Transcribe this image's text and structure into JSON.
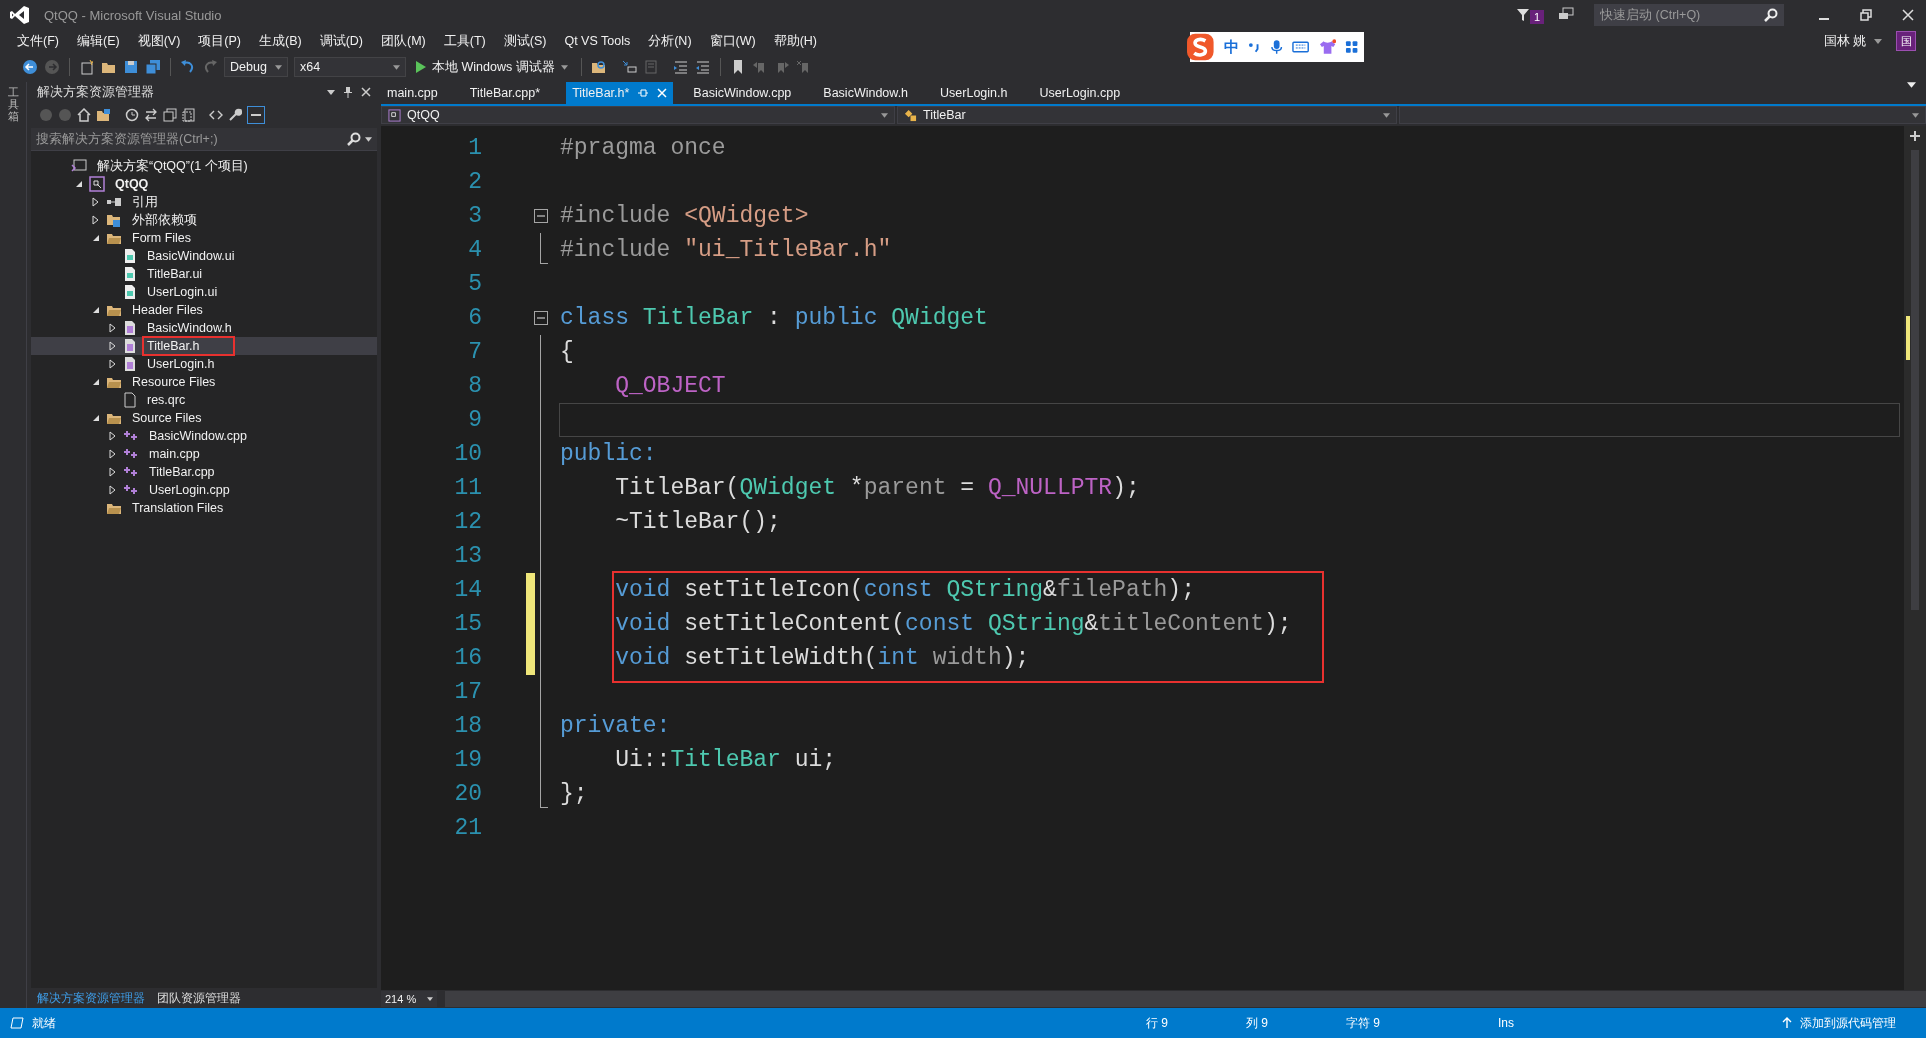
{
  "window": {
    "title": "QtQQ - Microsoft Visual Studio"
  },
  "notifications": {
    "count": "1"
  },
  "quick_launch": {
    "placeholder": "快速启动 (Ctrl+Q)"
  },
  "user": {
    "name": "国林 姚",
    "initial": "国"
  },
  "ime_toolbar": {
    "mode": "中"
  },
  "menu": [
    "文件(F)",
    "编辑(E)",
    "视图(V)",
    "项目(P)",
    "生成(B)",
    "调试(D)",
    "团队(M)",
    "工具(T)",
    "测试(S)",
    "Qt VS Tools",
    "分析(N)",
    "窗口(W)",
    "帮助(H)"
  ],
  "toolbar": {
    "configuration": "Debug",
    "platform": "x64",
    "run": "本地 Windows 调试器"
  },
  "toolbox_strip": {
    "label": "工具箱"
  },
  "solution_explorer": {
    "title": "解决方案资源管理器",
    "search_placeholder": "搜索解决方案资源管理器(Ctrl+;)",
    "tree": [
      {
        "label": "解决方案“QtQQ”(1 个项目)",
        "kind": "solution",
        "selected": false,
        "marked": false,
        "children": [
          {
            "label": "QtQQ",
            "kind": "project",
            "expanded": true,
            "selected": false,
            "marked": false,
            "children": [
              {
                "label": "引用",
                "kind": "references",
                "expanded": false,
                "selected": false,
                "marked": false
              },
              {
                "label": "外部依赖项",
                "kind": "external",
                "expanded": false,
                "selected": false,
                "marked": false
              },
              {
                "label": "Form Files",
                "kind": "folder",
                "expanded": true,
                "selected": false,
                "marked": false,
                "children": [
                  {
                    "label": "BasicWindow.ui",
                    "kind": "ui",
                    "selected": false,
                    "marked": false
                  },
                  {
                    "label": "TitleBar.ui",
                    "kind": "ui",
                    "selected": false,
                    "marked": false
                  },
                  {
                    "label": "UserLogin.ui",
                    "kind": "ui",
                    "selected": false,
                    "marked": false
                  }
                ]
              },
              {
                "label": "Header Files",
                "kind": "folder",
                "expanded": true,
                "selected": false,
                "marked": false,
                "children": [
                  {
                    "label": "BasicWindow.h",
                    "kind": "header",
                    "expanded": false,
                    "selected": false,
                    "marked": false
                  },
                  {
                    "label": "TitleBar.h",
                    "kind": "header",
                    "expanded": false,
                    "selected": true,
                    "marked": true
                  },
                  {
                    "label": "UserLogin.h",
                    "kind": "header",
                    "expanded": false,
                    "selected": false,
                    "marked": false
                  }
                ]
              },
              {
                "label": "Resource Files",
                "kind": "folder",
                "expanded": true,
                "selected": false,
                "marked": false,
                "children": [
                  {
                    "label": "res.qrc",
                    "kind": "file",
                    "selected": false,
                    "marked": false
                  }
                ]
              },
              {
                "label": "Source Files",
                "kind": "folder",
                "expanded": true,
                "selected": false,
                "marked": false,
                "children": [
                  {
                    "label": "BasicWindow.cpp",
                    "kind": "source",
                    "expanded": false,
                    "selected": false,
                    "marked": false
                  },
                  {
                    "label": "main.cpp",
                    "kind": "source",
                    "expanded": false,
                    "selected": false,
                    "marked": false
                  },
                  {
                    "label": "TitleBar.cpp",
                    "kind": "source",
                    "expanded": false,
                    "selected": false,
                    "marked": false
                  },
                  {
                    "label": "UserLogin.cpp",
                    "kind": "source",
                    "expanded": false,
                    "selected": false,
                    "marked": false
                  }
                ]
              },
              {
                "label": "Translation Files",
                "kind": "folder",
                "selected": false,
                "marked": false
              }
            ]
          }
        ]
      }
    ]
  },
  "bottom_tabs": [
    {
      "label": "解决方案资源管理器",
      "selected": true
    },
    {
      "label": "团队资源管理器",
      "selected": false
    }
  ],
  "editor": {
    "tabs": [
      {
        "label": "main.cpp",
        "selected": false
      },
      {
        "label": "TitleBar.cpp*",
        "selected": false
      },
      {
        "label": "TitleBar.h*",
        "selected": true
      },
      {
        "label": "BasicWindow.cpp",
        "selected": false
      },
      {
        "label": "BasicWindow.h",
        "selected": false
      },
      {
        "label": "UserLogin.h",
        "selected": false
      },
      {
        "label": "UserLogin.cpp",
        "selected": false
      }
    ],
    "nav": {
      "project": "QtQQ",
      "scope": "TitleBar"
    },
    "zoom": "214 %",
    "lines": [
      {
        "number": "1",
        "kind": "plain",
        "indented": false,
        "tokens": [
          {
            "kind": "pre",
            "text": "#pragma once"
          }
        ],
        "changed": false,
        "current": false,
        "marked": false
      },
      {
        "number": "2",
        "kind": "plain",
        "changed": false,
        "current": false,
        "marked": false
      },
      {
        "number": "3",
        "kind": "fold_start",
        "indented": false,
        "tokens": [
          {
            "kind": "pre",
            "text": "#include"
          },
          {
            "kind": "str",
            "text": " <QWidget>"
          }
        ],
        "changed": false,
        "current": false,
        "marked": false
      },
      {
        "number": "4",
        "kind": "fold_end",
        "indented": false,
        "tokens": [
          {
            "kind": "pre",
            "text": "#include"
          },
          {
            "kind": "str",
            "text": " \"ui_TitleBar.h\""
          }
        ],
        "changed": false,
        "current": false,
        "marked": false
      },
      {
        "number": "5",
        "kind": "plain",
        "changed": false,
        "current": false,
        "marked": false
      },
      {
        "number": "6",
        "kind": "fold_start",
        "indented": false,
        "tokens": [
          {
            "kind": "kw",
            "text": "class"
          },
          {
            "kind": "ty",
            "text": " TitleBar"
          },
          {
            "kind": "p",
            "text": " :"
          },
          {
            "kind": "kw",
            "text": " public"
          },
          {
            "kind": "ty",
            "text": " QWidget"
          }
        ],
        "changed": false,
        "current": false,
        "marked": false
      },
      {
        "number": "7",
        "kind": "fold_body",
        "indented": false,
        "tokens": [
          {
            "kind": "p",
            "text": "{"
          }
        ],
        "changed": false,
        "current": false,
        "marked": false
      },
      {
        "number": "8",
        "kind": "fold_body",
        "indented": true,
        "tokens": [
          {
            "kind": "mac",
            "text": "Q_OBJECT"
          }
        ],
        "changed": false,
        "current": false,
        "marked": false
      },
      {
        "number": "9",
        "kind": "fold_body",
        "changed": false,
        "current": true,
        "marked": false
      },
      {
        "number": "10",
        "kind": "fold_body",
        "indented": false,
        "tokens": [
          {
            "kind": "kw",
            "text": "public:"
          }
        ],
        "changed": false,
        "current": false,
        "marked": false
      },
      {
        "number": "11",
        "kind": "fold_body",
        "indented": true,
        "tokens": [
          {
            "kind": "p",
            "text": "TitleBar("
          },
          {
            "kind": "ty",
            "text": "QWidget"
          },
          {
            "kind": "p",
            "text": " *"
          },
          {
            "kind": "prm",
            "text": "parent"
          },
          {
            "kind": "p",
            "text": " ="
          },
          {
            "kind": "mac",
            "text": " Q_NULLPTR"
          },
          {
            "kind": "p",
            "text": ");"
          }
        ],
        "changed": false,
        "current": false,
        "marked": false
      },
      {
        "number": "12",
        "kind": "fold_body",
        "indented": true,
        "tokens": [
          {
            "kind": "p",
            "text": "~TitleBar();"
          }
        ],
        "changed": false,
        "current": false,
        "marked": false
      },
      {
        "number": "13",
        "kind": "fold_body",
        "changed": false,
        "current": false,
        "marked": false
      },
      {
        "number": "14",
        "kind": "fold_body",
        "indented": true,
        "tokens": [
          {
            "kind": "kw",
            "text": "void"
          },
          {
            "kind": "p",
            "text": " setTitleIcon("
          },
          {
            "kind": "kw",
            "text": "const"
          },
          {
            "kind": "ty",
            "text": " QString"
          },
          {
            "kind": "p",
            "text": "&"
          },
          {
            "kind": "prm",
            "text": "filePath"
          },
          {
            "kind": "p",
            "text": ");"
          }
        ],
        "changed": true,
        "current": false,
        "marked": true
      },
      {
        "number": "15",
        "kind": "fold_body",
        "indented": true,
        "tokens": [
          {
            "kind": "kw",
            "text": "void"
          },
          {
            "kind": "p",
            "text": " setTitleContent("
          },
          {
            "kind": "kw",
            "text": "const"
          },
          {
            "kind": "ty",
            "text": " QString"
          },
          {
            "kind": "p",
            "text": "&"
          },
          {
            "kind": "prm",
            "text": "titleContent"
          },
          {
            "kind": "p",
            "text": ");"
          }
        ],
        "changed": true,
        "current": false,
        "marked": true
      },
      {
        "number": "16",
        "kind": "fold_body",
        "indented": true,
        "tokens": [
          {
            "kind": "kw",
            "text": "void"
          },
          {
            "kind": "p",
            "text": " setTitleWidth("
          },
          {
            "kind": "kw",
            "text": "int"
          },
          {
            "kind": "prm",
            "text": " width"
          },
          {
            "kind": "p",
            "text": ");"
          }
        ],
        "changed": true,
        "current": false,
        "marked": true
      },
      {
        "number": "17",
        "kind": "fold_body",
        "changed": false,
        "current": false,
        "marked": false
      },
      {
        "number": "18",
        "kind": "fold_body",
        "indented": false,
        "tokens": [
          {
            "kind": "kw",
            "text": "private:"
          }
        ],
        "changed": false,
        "current": false,
        "marked": false
      },
      {
        "number": "19",
        "kind": "fold_body",
        "indented": true,
        "tokens": [
          {
            "kind": "p",
            "text": "Ui::"
          },
          {
            "kind": "ty",
            "text": "TitleBar"
          },
          {
            "kind": "p",
            "text": " ui;"
          }
        ],
        "changed": false,
        "current": false,
        "marked": false
      },
      {
        "number": "20",
        "kind": "fold_end",
        "indented": false,
        "tokens": [
          {
            "kind": "p",
            "text": "};"
          }
        ],
        "changed": false,
        "current": false,
        "marked": false
      },
      {
        "number": "21",
        "kind": "plain",
        "changed": false,
        "current": false,
        "marked": false
      }
    ]
  },
  "status_bar": {
    "state": "就绪",
    "line": "行 9",
    "column": "列 9",
    "char": "字符 9",
    "mode": "Ins",
    "source_control": "添加到源代码管理"
  }
}
